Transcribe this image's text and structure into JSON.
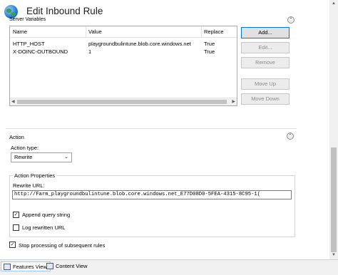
{
  "window": {
    "title": "Edit Inbound Rule"
  },
  "server_variables": {
    "section_label": "Server Variables",
    "columns": [
      "Name",
      "Value",
      "Replace"
    ],
    "rows": [
      {
        "name": "HTTP_HOST",
        "value": "playgroundbulintune.blob.core.windows.net",
        "replace": "True"
      },
      {
        "name": "X-DOINC-OUTBOUND",
        "value": "1",
        "replace": "True"
      }
    ],
    "buttons": {
      "add": "Add...",
      "edit": "Edit...",
      "remove": "Remove",
      "move_up": "Move Up",
      "move_down": "Move Down"
    }
  },
  "action": {
    "section_label": "Action",
    "action_type_label": "Action type:",
    "action_type_value": "Rewrite",
    "properties_label": "Action Properties",
    "rewrite_url_label": "Rewrite URL:",
    "rewrite_url_value": "http://Farm_playgroundbulintune.blob.core.windows.net_E77D08D0-5FEA-4315-8C95-1(",
    "append_query_label": "Append query string",
    "append_query_checked": true,
    "log_rewritten_label": "Log rewritten URL",
    "log_rewritten_checked": false,
    "stop_processing_label": "Stop processing of subsequent rules",
    "stop_processing_checked": true
  },
  "footer": {
    "features_view": "Features View",
    "content_view": "Content View"
  },
  "icons": {
    "title": "globe-icon",
    "collapse": "chevron-up-icon",
    "dropdown": "chevron-down-icon"
  },
  "colors": {
    "accent": "#0078d7"
  }
}
